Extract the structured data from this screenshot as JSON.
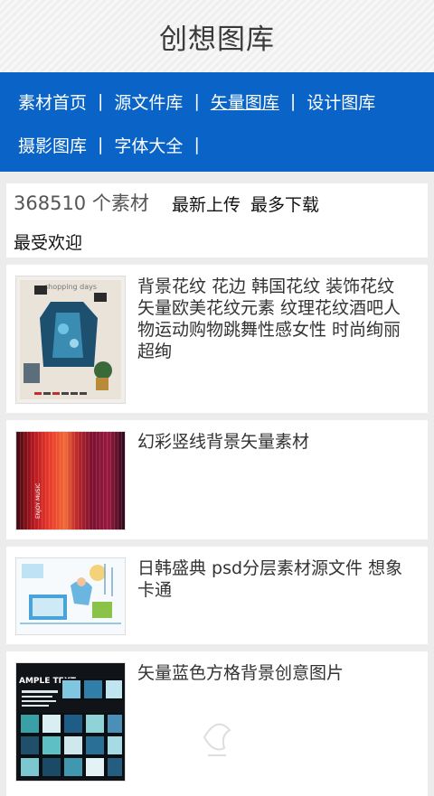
{
  "header": {
    "title": "创想图库"
  },
  "nav": {
    "row1": [
      "素材首页",
      "源文件库",
      "矢量图库",
      "设计图库"
    ],
    "row2": [
      "摄影图库",
      "字体大全"
    ],
    "separator": "|"
  },
  "stats": {
    "count": "368510 个素材",
    "latest": "最新上传",
    "most_downloaded": "最多下载",
    "most_popular": "最受欢迎"
  },
  "items": [
    {
      "title": "背景花纹 花边 韩国花纹 装饰花纹 矢量欧美花纹元素 纹理花纹酒吧人物运动购物跳舞性感女性 时尚绚丽 超绚"
    },
    {
      "title": "幻彩竖线背景矢量素材"
    },
    {
      "title": "日韩盛典 psd分层素材源文件 想象 卡通"
    },
    {
      "title": "矢量蓝色方格背景创意图片"
    }
  ],
  "thumb_text": {
    "t1_top": "shopping days",
    "t2_side": "ENJOY MUSIC",
    "t4_header": "AMPLE TEXT"
  },
  "colors": {
    "nav_bg": "#0a64c7",
    "page_bg": "#ececec",
    "card_bg": "#ffffff"
  }
}
